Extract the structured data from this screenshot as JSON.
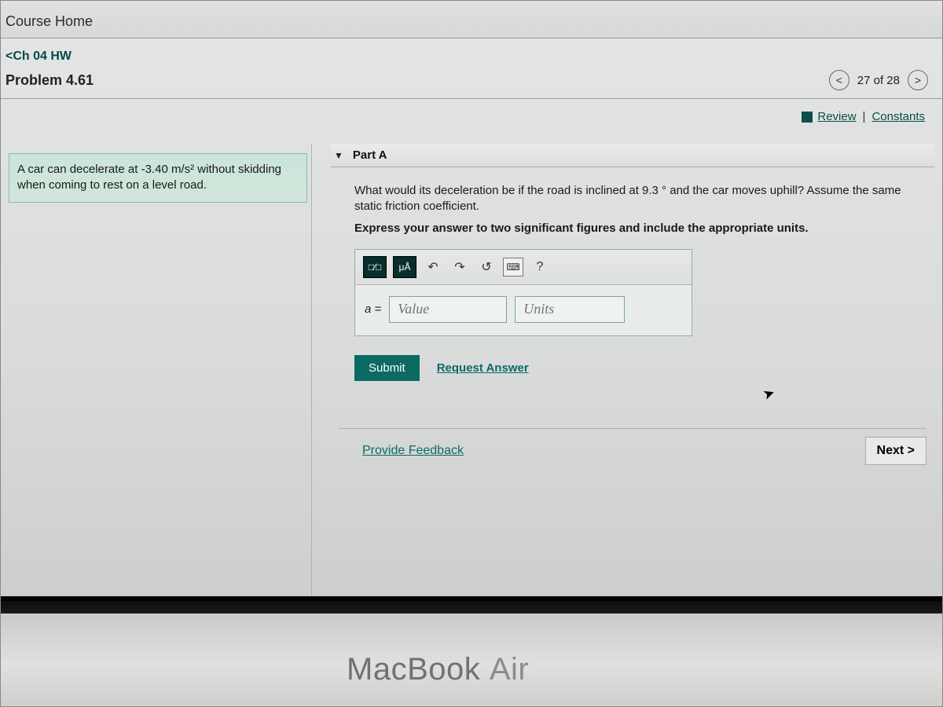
{
  "course_home": "Course Home",
  "hw_link": "<Ch 04 HW",
  "problem_title": "Problem 4.61",
  "nav": {
    "prev": "<",
    "counter": "27 of 28",
    "next": ">"
  },
  "review": {
    "review": "Review",
    "sep": "|",
    "constants": "Constants"
  },
  "stem_html": "A car can decelerate at -3.40  m/s²  without skidding when coming to rest on a level road.",
  "part": {
    "tri": "▼",
    "label": "Part A"
  },
  "question": "What would its deceleration be if the road is inclined at 9.3 °  and the car moves uphill? Assume the same static friction coefficient.",
  "instruction": "Express your answer to two significant figures and include the appropriate units.",
  "toolbar": {
    "templates": "□⁄□",
    "symbols": "μÅ",
    "undo": "↶",
    "redo": "↷",
    "reset": "↺",
    "keyboard": "⌨",
    "help": "?"
  },
  "answer": {
    "var": "a =",
    "value_ph": "Value",
    "units_ph": "Units"
  },
  "submit": "Submit",
  "request_answer": "Request Answer",
  "feedback": "Provide Feedback",
  "next": "Next >",
  "bezel1": "MacBook ",
  "bezel2": "Air"
}
